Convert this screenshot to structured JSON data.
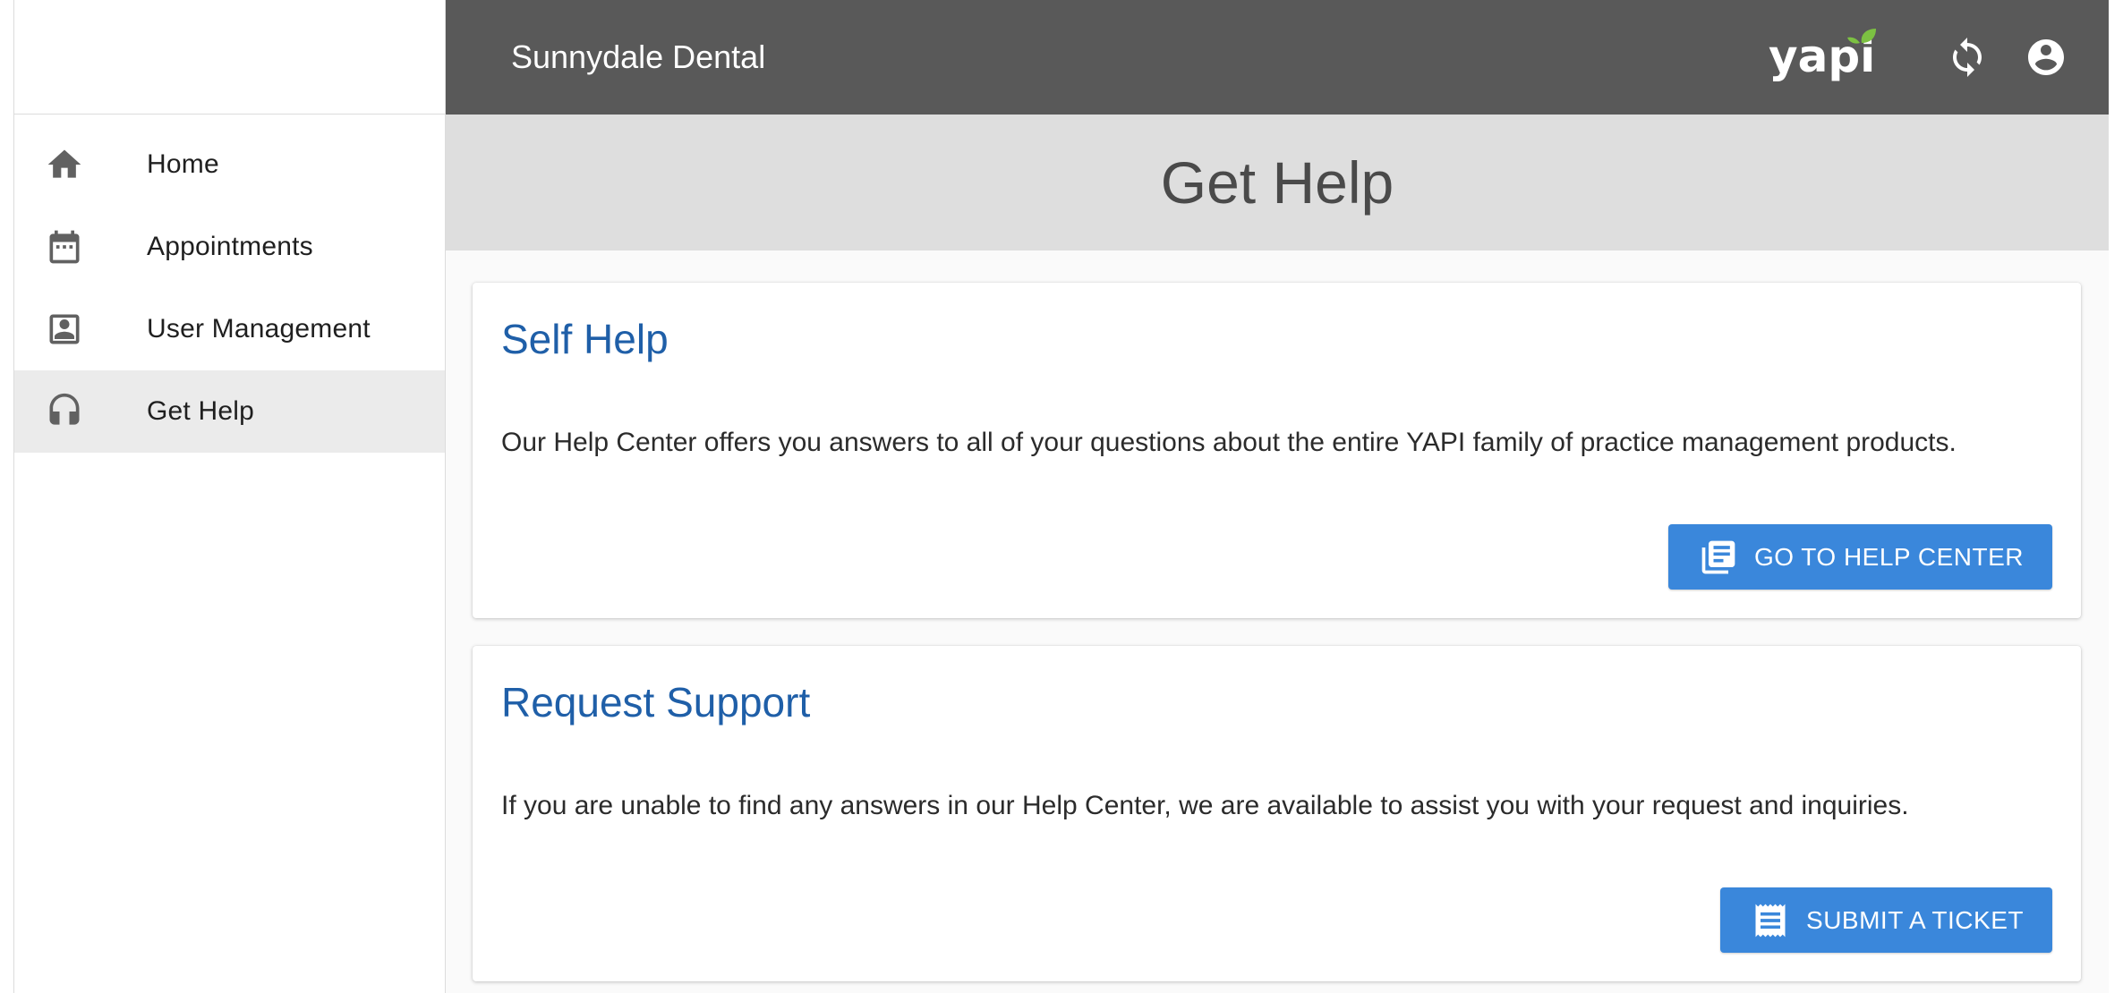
{
  "header": {
    "practice_name": "Sunnydale Dental",
    "logo_text": "yapi",
    "icons": [
      "sync-icon",
      "account-circle-icon"
    ]
  },
  "sidebar": {
    "items": [
      {
        "label": "Home",
        "icon": "home-icon",
        "active": false
      },
      {
        "label": "Appointments",
        "icon": "calendar-icon",
        "active": false
      },
      {
        "label": "User Management",
        "icon": "contact-card-icon",
        "active": false
      },
      {
        "label": "Get Help",
        "icon": "headset-icon",
        "active": true
      }
    ]
  },
  "page": {
    "title": "Get Help"
  },
  "cards": {
    "self_help": {
      "title": "Self Help",
      "text": "Our Help Center offers you answers to all of your questions about the entire YAPI family of practice management products.",
      "button_label": "GO TO HELP CENTER",
      "button_icon": "library-books-icon"
    },
    "request_support": {
      "title": "Request Support",
      "text": "If you are unable to find any answers in our Help Center, we are available to assist you with your request and inquiries.",
      "button_label": "SUBMIT A TICKET",
      "button_icon": "receipt-icon"
    }
  },
  "colors": {
    "header_bg": "#595959",
    "accent_blue": "#3a87db",
    "title_blue": "#1f5fa8",
    "logo_leaf": "#7cc142"
  }
}
